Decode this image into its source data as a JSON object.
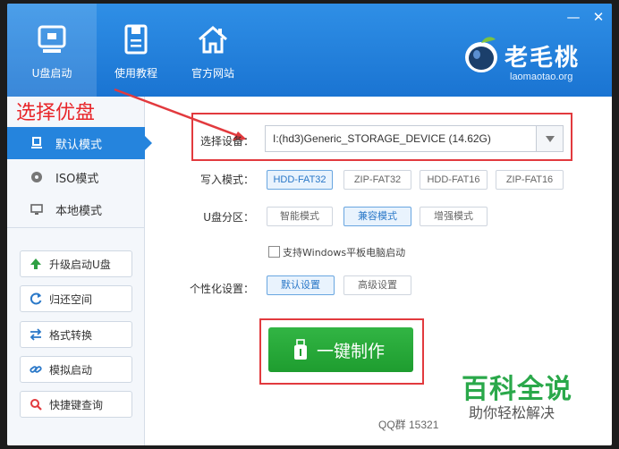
{
  "header": {
    "nav": [
      {
        "label": "U盘启动",
        "icon": "usb-drive-icon",
        "active": true
      },
      {
        "label": "使用教程",
        "icon": "document-icon",
        "active": false
      },
      {
        "label": "官方网站",
        "icon": "home-icon",
        "active": false
      }
    ],
    "minimize": "—",
    "close": "✕",
    "logo_text": "老毛桃",
    "logo_domain": "laomaotao.org"
  },
  "annotation": "选择优盘",
  "sidebar": {
    "modes": [
      {
        "label": "默认模式",
        "icon": "usb-mode-icon",
        "active": true
      },
      {
        "label": "ISO模式",
        "icon": "disc-icon",
        "active": false
      },
      {
        "label": "本地模式",
        "icon": "monitor-icon",
        "active": false
      }
    ],
    "tools": [
      {
        "label": "升级启动U盘",
        "icon": "up-arrow-icon",
        "color": "#2ea043"
      },
      {
        "label": "归还空间",
        "icon": "refresh-icon",
        "color": "#2a78c8"
      },
      {
        "label": "格式转换",
        "icon": "swap-icon",
        "color": "#2a78c8"
      },
      {
        "label": "模拟启动",
        "icon": "link-icon",
        "color": "#2a78c8"
      },
      {
        "label": "快捷键查询",
        "icon": "search-icon",
        "color": "#e23a3e"
      }
    ]
  },
  "main": {
    "device_label": "选择设备：",
    "device_value": "I:(hd3)Generic_STORAGE_DEVICE (14.62G)",
    "write_mode_label": "写入模式：",
    "write_modes": [
      {
        "label": "HDD-FAT32",
        "selected": true
      },
      {
        "label": "ZIP-FAT32",
        "selected": false
      },
      {
        "label": "HDD-FAT16",
        "selected": false
      },
      {
        "label": "ZIP-FAT16",
        "selected": false
      }
    ],
    "partition_label": "U盘分区：",
    "partitions": [
      {
        "label": "智能模式",
        "selected": false
      },
      {
        "label": "兼容模式",
        "selected": true
      },
      {
        "label": "增强模式",
        "selected": false
      }
    ],
    "tablet_checkbox_label": "支持Windows平板电脑启动",
    "tablet_checked": false,
    "personalize_label": "个性化设置：",
    "personalize_options": [
      {
        "label": "默认设置",
        "selected": true
      },
      {
        "label": "高级设置",
        "selected": false
      }
    ],
    "make_button": "一键制作",
    "qq_text": "QQ群 15321"
  },
  "watermark": {
    "title": "百科全说",
    "subtitle": "助你轻松解决"
  },
  "colors": {
    "header_blue": "#1a74d2",
    "sidebar_active": "#2584dd",
    "make_green": "#1e9d2f",
    "highlight_red": "#e23a3e",
    "watermark_green": "#2aa84a"
  }
}
